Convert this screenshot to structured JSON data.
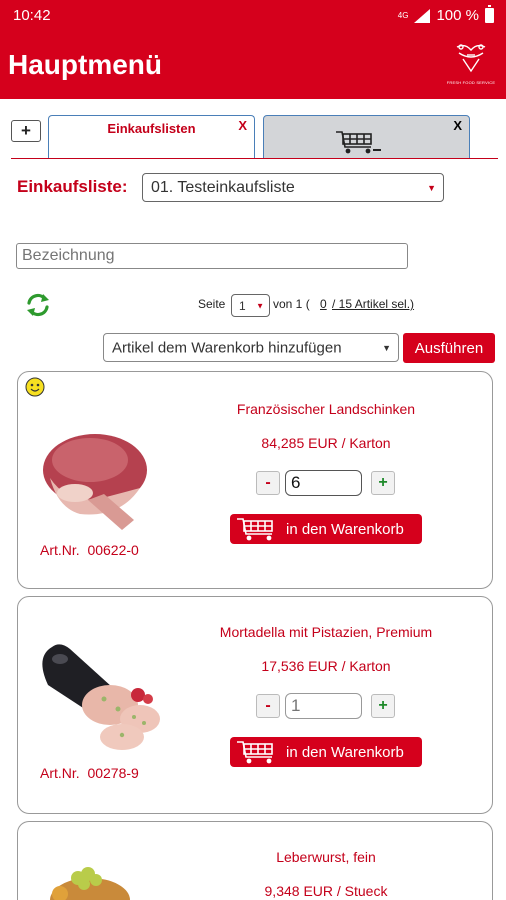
{
  "status": {
    "time": "10:42",
    "network": "4G",
    "battery": "100 %"
  },
  "header": {
    "title": "Hauptmenü",
    "logo_text": "FRESH FOOD SERVICE"
  },
  "tabs": {
    "add_label": "+",
    "items": [
      {
        "label": "Einkaufslisten",
        "close": "X",
        "active": true
      },
      {
        "label": "",
        "close": "X",
        "icon": "cart-icon",
        "active": false
      }
    ]
  },
  "shopping_list": {
    "label": "Einkaufsliste:",
    "selected": "01. Testeinkaufsliste"
  },
  "search": {
    "placeholder": "Bezeichnung"
  },
  "pager": {
    "prefix": "Seite",
    "page": "1",
    "of_text": "von 1 (",
    "selected_count": "0",
    "total_text": " / 15 Artikel sel.)"
  },
  "action": {
    "selected": "Artikel dem Warenkorb hinzufügen",
    "execute_label": "Ausführen"
  },
  "products": [
    {
      "name": "Französischer Landschinken",
      "price": "84,285 EUR / Karton",
      "qty": "6",
      "add_label": "in den Warenkorb",
      "artnr_label": "Art.Nr.",
      "artnr": "00622-0",
      "image": "ham-image",
      "smiley": true
    },
    {
      "name": "Mortadella mit Pistazien, Premium",
      "price": "17,536 EUR / Karton",
      "qty_placeholder": "1",
      "add_label": "in den Warenkorb",
      "artnr_label": "Art.Nr.",
      "artnr": "00278-9",
      "image": "mortadella-image",
      "smiley": false
    },
    {
      "name": "Leberwurst, fein",
      "price": "9,348 EUR / Stueck",
      "image": "liverwurst-image"
    }
  ],
  "colors": {
    "brand_red": "#d5001c",
    "tab_border": "#4a7fb8",
    "plus_green": "#1e8a2a",
    "refresh_green": "#2e9a2e"
  }
}
